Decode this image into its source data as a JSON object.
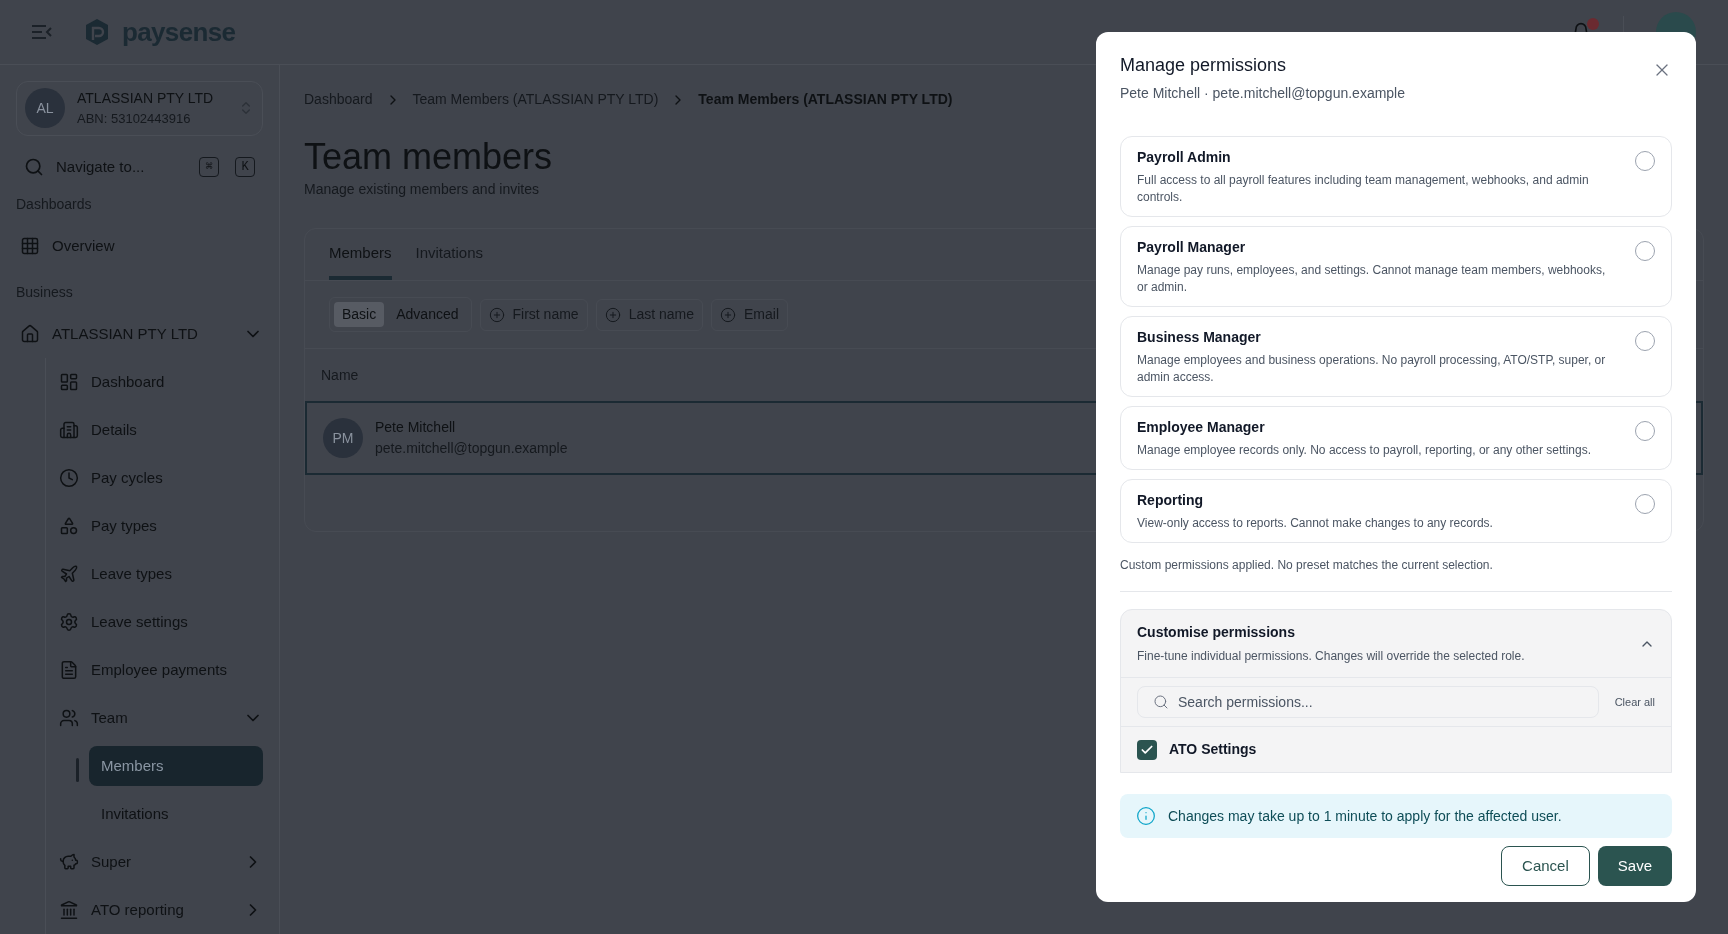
{
  "header": {
    "logo": "paysense",
    "notification": {
      "unread": true
    }
  },
  "org_switcher": {
    "initials": "AL",
    "name": "ATLASSIAN PTY LTD",
    "abn": "ABN: 53102443916"
  },
  "navigate": {
    "placeholder": "Navigate to...",
    "keys": [
      "⌘",
      "K"
    ]
  },
  "sidebar": {
    "sections": [
      {
        "heading": "Dashboards",
        "items": [
          {
            "label": "Overview",
            "kind": "link",
            "selected": false
          }
        ]
      },
      {
        "heading": "Business",
        "items": [
          {
            "label": "ATLASSIAN PTY LTD",
            "kind": "group",
            "selected": false,
            "expanded": true,
            "children": [
              {
                "label": "Dashboard",
                "kind": "link",
                "selected": false
              },
              {
                "label": "Details",
                "kind": "link",
                "selected": false
              },
              {
                "label": "Pay cycles",
                "kind": "link",
                "selected": false
              },
              {
                "label": "Pay types",
                "kind": "link",
                "selected": false
              },
              {
                "label": "Leave types",
                "kind": "link",
                "selected": false
              },
              {
                "label": "Leave settings",
                "kind": "link",
                "selected": false
              },
              {
                "label": "Employee payments",
                "kind": "link",
                "selected": false
              },
              {
                "label": "Team",
                "kind": "group",
                "selected": false,
                "expanded": true,
                "children": [
                  {
                    "label": "Members",
                    "kind": "link",
                    "selected": true
                  },
                  {
                    "label": "Invitations",
                    "kind": "link",
                    "selected": false
                  }
                ]
              },
              {
                "label": "Super",
                "kind": "group",
                "selected": false,
                "expanded": false
              },
              {
                "label": "ATO reporting",
                "kind": "group",
                "selected": false,
                "expanded": false
              }
            ]
          }
        ]
      }
    ]
  },
  "breadcrumbs": [
    {
      "label": "Dashboard",
      "current": false
    },
    {
      "label": "Team Members (ATLASSIAN PTY LTD)",
      "current": false
    },
    {
      "label": "Team Members (ATLASSIAN PTY LTD)",
      "current": true
    }
  ],
  "page": {
    "title": "Team members",
    "subtitle": "Manage existing members and invites"
  },
  "tabs": [
    {
      "label": "Members",
      "selected": true
    },
    {
      "label": "Invitations",
      "selected": false
    }
  ],
  "filter_modes": [
    {
      "label": "Basic",
      "selected": true
    },
    {
      "label": "Advanced",
      "selected": false
    }
  ],
  "filters": [
    "First name",
    "Last name",
    "Email"
  ],
  "table": {
    "columns": [
      "Name"
    ],
    "rows": [
      {
        "initials": "PM",
        "name": "Pete Mitchell",
        "email": "pete.mitchell@topgun.example",
        "selected": true
      }
    ]
  },
  "dialog": {
    "title": "Manage permissions",
    "subtitle": "Pete Mitchell · pete.mitchell@topgun.example",
    "roles": [
      {
        "name": "Payroll Admin",
        "description": "Full access to all payroll features including team management, webhooks, and admin controls.",
        "selected": false
      },
      {
        "name": "Payroll Manager",
        "description": "Manage pay runs, employees, and settings. Cannot manage team members, webhooks, or admin.",
        "selected": false
      },
      {
        "name": "Business Manager",
        "description": "Manage employees and business operations. No payroll processing, ATO/STP, super, or admin access.",
        "selected": false
      },
      {
        "name": "Employee Manager",
        "description": "Manage employee records only. No access to payroll, reporting, or any other settings.",
        "selected": false
      },
      {
        "name": "Reporting",
        "description": "View-only access to reports. Cannot make changes to any records.",
        "selected": false
      }
    ],
    "note": "Custom permissions applied. No preset matches the current selection.",
    "customise": {
      "title": "Customise permissions",
      "description": "Fine-tune individual permissions. Changes will override the selected role.",
      "expanded": true,
      "search_placeholder": "Search permissions...",
      "clear_all": "Clear all",
      "permissions": [
        {
          "label": "ATO Settings",
          "checked": true
        }
      ]
    },
    "info": "Changes may take up to 1 minute to apply for the affected user.",
    "buttons": [
      {
        "label": "Cancel",
        "kind": "secondary"
      },
      {
        "label": "Save",
        "kind": "primary"
      }
    ]
  }
}
